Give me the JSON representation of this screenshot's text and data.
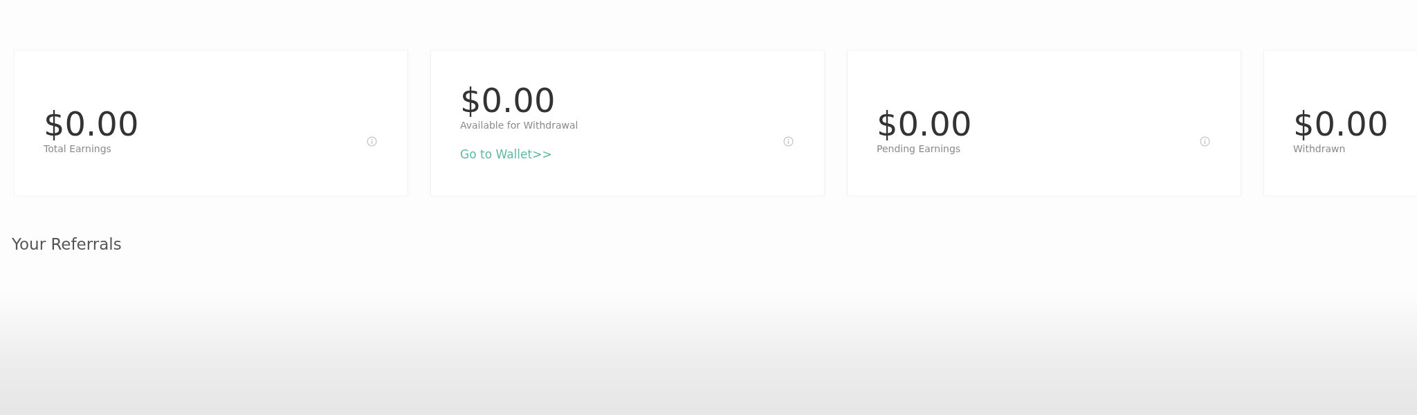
{
  "stats": [
    {
      "amount": "$0.00",
      "label": "Total Earnings"
    },
    {
      "amount": "$0.00",
      "label": "Available for Withdrawal",
      "link": "Go to Wallet>>"
    },
    {
      "amount": "$0.00",
      "label": "Pending Earnings"
    },
    {
      "amount": "$0.00",
      "label": "Withdrawn"
    }
  ],
  "referrals": {
    "title": "Your Referrals"
  }
}
